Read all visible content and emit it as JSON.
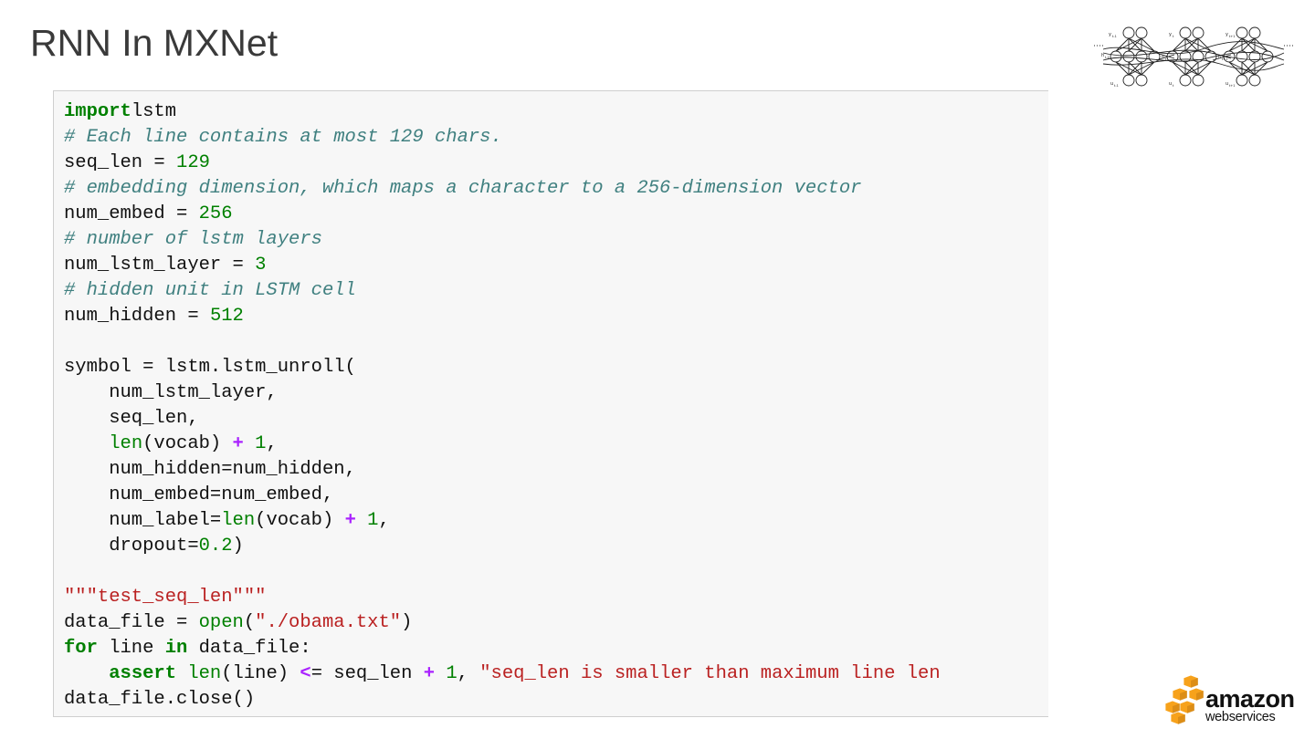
{
  "slide": {
    "title": "RNN In MXNet"
  },
  "diagram": {
    "icon": "rnn-unrolled-diagram-icon",
    "labels": [
      "y t-1",
      "y t",
      "y t+1",
      "h t-1",
      "h t",
      "h t+1",
      "u t-1",
      "u t",
      "u t+1"
    ]
  },
  "code": {
    "lines": [
      [
        [
          "kw",
          "import"
        ],
        [
          "",
          "lstm"
        ]
      ],
      [
        [
          "cm",
          "# Each line contains at most 129 chars."
        ]
      ],
      [
        [
          "",
          "seq_len = "
        ],
        [
          "num",
          "129"
        ]
      ],
      [
        [
          "cm",
          "# embedding dimension, which maps a character to a 256-dimension vector"
        ]
      ],
      [
        [
          "",
          "num_embed = "
        ],
        [
          "num",
          "256"
        ]
      ],
      [
        [
          "cm",
          "# number of lstm layers"
        ]
      ],
      [
        [
          "",
          "num_lstm_layer = "
        ],
        [
          "num",
          "3"
        ]
      ],
      [
        [
          "cm",
          "# hidden unit in LSTM cell"
        ]
      ],
      [
        [
          "",
          "num_hidden = "
        ],
        [
          "num",
          "512"
        ]
      ],
      [],
      [
        [
          "",
          "symbol = lstm.lstm_unroll("
        ]
      ],
      [
        [
          "",
          "    num_lstm_layer,"
        ]
      ],
      [
        [
          "",
          "    seq_len,"
        ]
      ],
      [
        [
          "",
          "    "
        ],
        [
          "bi",
          "len"
        ],
        [
          "",
          "(vocab) "
        ],
        [
          "op",
          "+"
        ],
        [
          "",
          ""
        ],
        [
          "num",
          " 1"
        ],
        [
          "",
          ","
        ]
      ],
      [
        [
          "",
          "    num_hidden=num_hidden,"
        ]
      ],
      [
        [
          "",
          "    num_embed=num_embed,"
        ]
      ],
      [
        [
          "",
          "    num_label="
        ],
        [
          "bi",
          "len"
        ],
        [
          "",
          "(vocab) "
        ],
        [
          "op",
          "+"
        ],
        [
          "num",
          " 1"
        ],
        [
          "",
          ","
        ]
      ],
      [
        [
          "",
          "    dropout="
        ],
        [
          "num",
          "0.2"
        ],
        [
          "",
          ")"
        ]
      ],
      [],
      [
        [
          "str",
          "\"\"\"test_seq_len\"\"\""
        ]
      ],
      [
        [
          "",
          "data_file = "
        ],
        [
          "bi",
          "open"
        ],
        [
          "",
          "("
        ],
        [
          "str",
          "\"./obama.txt\""
        ],
        [
          "",
          ")"
        ]
      ],
      [
        [
          "kw",
          "for"
        ],
        [
          "",
          " line "
        ],
        [
          "kw",
          "in"
        ],
        [
          "",
          " data_file:"
        ]
      ],
      [
        [
          "",
          "    "
        ],
        [
          "kw",
          "assert"
        ],
        [
          "",
          ""
        ],
        [
          "bi",
          " len"
        ],
        [
          "",
          "(line) "
        ],
        [
          "op",
          "<"
        ],
        [
          "",
          "= seq_len "
        ],
        [
          "op",
          "+"
        ],
        [
          "num",
          " 1"
        ],
        [
          "",
          ", "
        ],
        [
          "str",
          "\"seq_len is smaller than maximum line len"
        ]
      ],
      [
        [
          "",
          "data_file.close()"
        ]
      ]
    ]
  },
  "brand": {
    "logo_line1": "amazon",
    "logo_line2": "webservices",
    "logo_color": "#f7a21b"
  }
}
